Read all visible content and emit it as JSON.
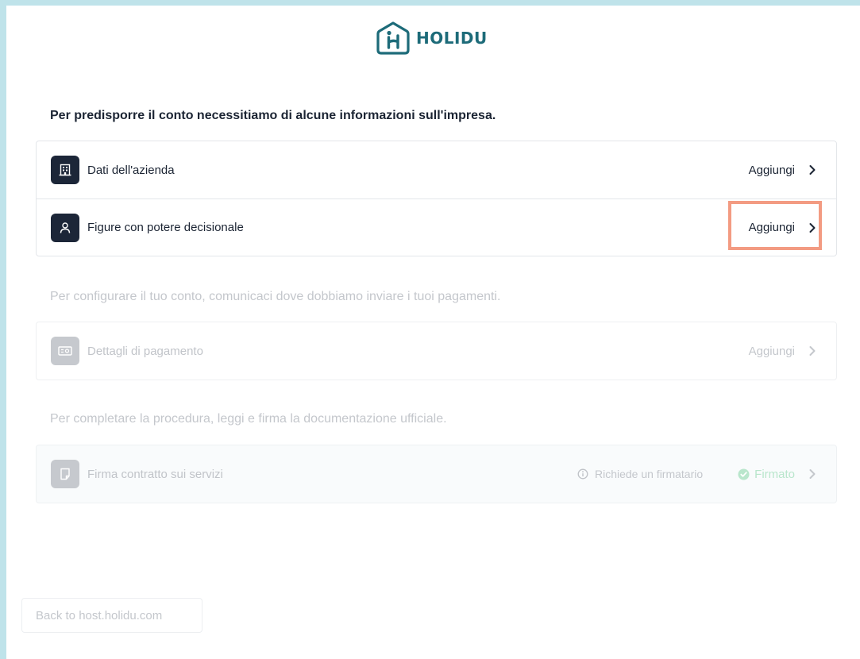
{
  "brand": {
    "name": "HOLIDU",
    "logo_icon": "house-h-icon",
    "color": "#1d6b79"
  },
  "sections": [
    {
      "title": "Per predisporre il conto necessitiamo di alcune informazioni sull'impresa.",
      "items": [
        {
          "label": "Dati dell'azienda",
          "icon": "building-icon",
          "action": "Aggiungi"
        },
        {
          "label": "Figure con potere decisionale",
          "icon": "person-icon",
          "action": "Aggiungi"
        }
      ]
    },
    {
      "title": "Per configurare il tuo conto, comunicaci dove dobbiamo inviare i tuoi pagamenti.",
      "items": [
        {
          "label": "Dettagli di pagamento",
          "icon": "banknote-icon",
          "action": "Aggiungi"
        }
      ]
    },
    {
      "title": "Per completare la procedura, leggi e firma la documentazione ufficiale.",
      "items": [
        {
          "label": "Firma contratto sui servizi",
          "icon": "document-icon",
          "info": "Richiede un firmatario",
          "status": "Firmato"
        }
      ]
    }
  ],
  "back_button": {
    "label": "Back to host.holidu.com"
  },
  "colors": {
    "background": "#bfe3ea",
    "icon_dark": "#1c2638",
    "highlight": "#f39b82",
    "signed_green": "#7ed3a3"
  }
}
